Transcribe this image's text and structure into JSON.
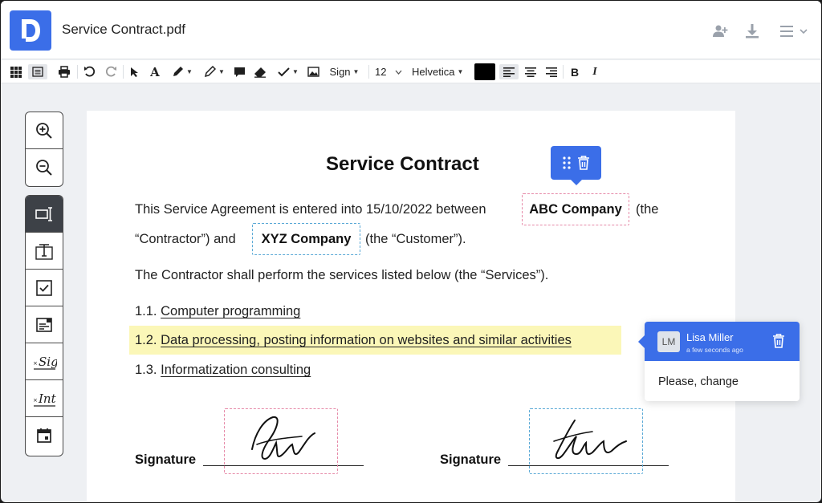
{
  "header": {
    "title": "Service Contract.pdf",
    "icons": [
      "add-user-icon",
      "download-icon",
      "menu-icon"
    ]
  },
  "toolbar": {
    "sign_label": "Sign",
    "font_size": "12",
    "font_name": "Helvetica",
    "text_color": "#000000"
  },
  "document": {
    "title": "Service Contract",
    "para1_a": "This Service Agreement is entered into 15/10/2022 between",
    "field_contractor": "ABC Company",
    "para1_b": "(the",
    "para1_c": "“Contractor”) and",
    "field_customer": "XYZ Company",
    "para1_d": "(the “Customer”).",
    "para2": "The Contractor shall perform the services listed below (the “Services”).",
    "items": [
      {
        "num": "1.1.",
        "text": "Computer programming"
      },
      {
        "num": "1.2.",
        "text": "Data processing, posting information on websites and similar activities"
      },
      {
        "num": "1.3.",
        "text": "Informatization consulting"
      }
    ],
    "signature_label_1": "Signature",
    "signature_label_2": "Signature"
  },
  "comment": {
    "initials": "LM",
    "author": "Lisa Miller",
    "time": "a few seconds ago",
    "text": "Please, change"
  },
  "colors": {
    "accent": "#3b6ee8",
    "highlight": "#fbf7b8",
    "field_pink": "#e68aa8",
    "field_blue": "#5aa9d6"
  }
}
